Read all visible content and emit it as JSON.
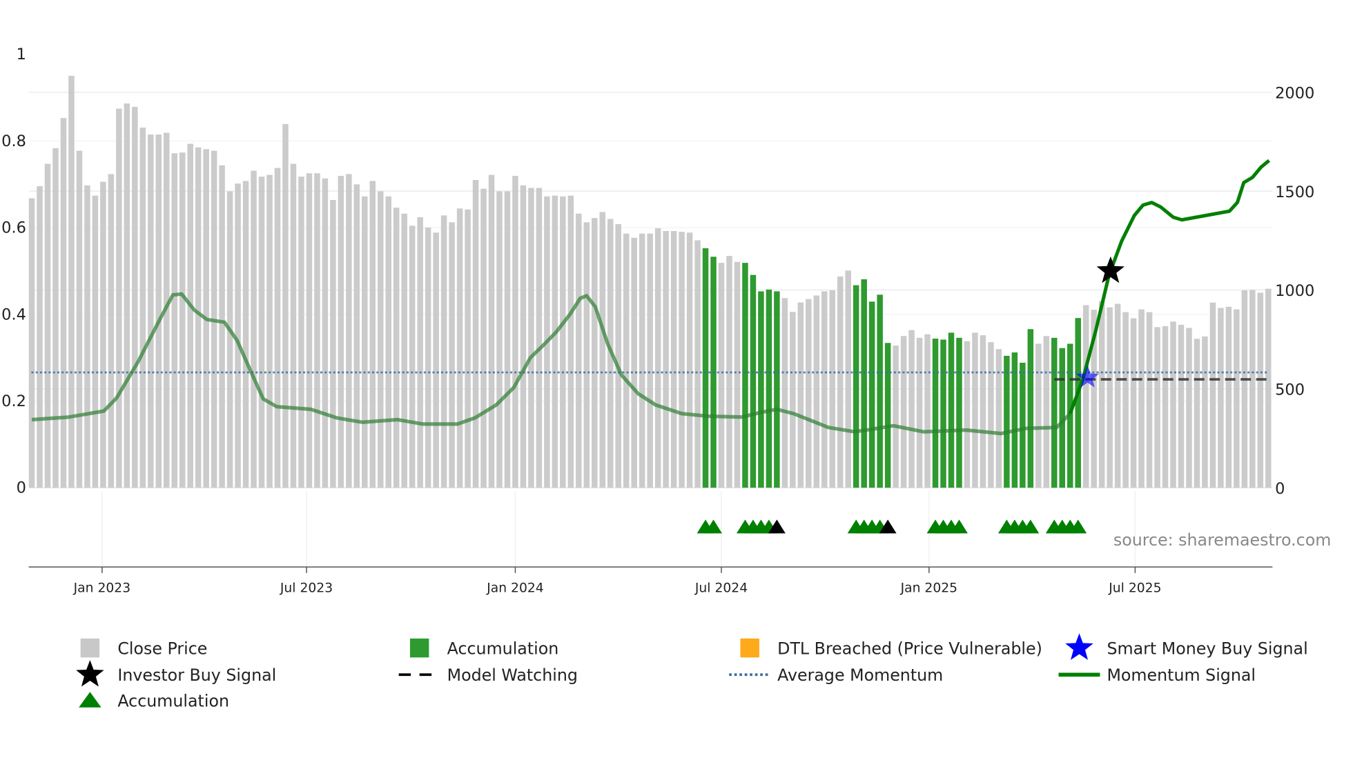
{
  "chart_data": {
    "type": "bar",
    "title": "",
    "source": "source: sharemaestro.com",
    "x_unit": "week index",
    "x_ticks": [
      {
        "label": "Jan 2023",
        "week": 8.87
      },
      {
        "label": "Jul 2023",
        "week": 34.66
      },
      {
        "label": "Jan 2024",
        "week": 61.0
      },
      {
        "label": "Jul 2024",
        "week": 87.0
      },
      {
        "label": "Jan 2025",
        "week": 113.2
      },
      {
        "label": "Jul 2025",
        "week": 139.2
      }
    ],
    "left_axis": {
      "range": [
        0,
        1
      ],
      "ticks": [
        "0",
        "0.2",
        "0.4",
        "0.6",
        "0.8",
        "1"
      ],
      "tick_values": [
        0,
        0.2,
        0.4,
        0.6,
        0.8,
        1
      ]
    },
    "right_axis": {
      "range": [
        0,
        2190
      ],
      "ticks": [
        "0",
        "500",
        "1000",
        "1500",
        "2000"
      ],
      "tick_values": [
        0,
        500,
        1000,
        1500,
        2000
      ]
    },
    "close_price": [
      1464,
      1525,
      1638,
      1717,
      1869,
      2083,
      1704,
      1529,
      1477,
      1547,
      1586,
      1917,
      1943,
      1926,
      1821,
      1786,
      1786,
      1795,
      1691,
      1695,
      1739,
      1721,
      1712,
      1704,
      1630,
      1499,
      1538,
      1551,
      1603,
      1573,
      1582,
      1617,
      1839,
      1638,
      1573,
      1590,
      1590,
      1564,
      1455,
      1577,
      1586,
      1534,
      1473,
      1551,
      1499,
      1473,
      1416,
      1386,
      1325,
      1368,
      1316,
      1290,
      1377,
      1342,
      1412,
      1407,
      1556,
      1512,
      1582,
      1499,
      1499,
      1577,
      1529,
      1516,
      1516,
      1473,
      1477,
      1473,
      1477,
      1386,
      1342,
      1364,
      1394,
      1359,
      1333,
      1285,
      1264,
      1285,
      1285,
      1312,
      1298,
      1298,
      1294,
      1290,
      1251,
      1211,
      1168,
      1137,
      1172,
      1142,
      1137,
      1076,
      993,
      1002,
      993,
      959,
      889,
      937,
      954,
      972,
      993,
      998,
      1068,
      1098,
      1024,
      1054,
      941,
      976,
      732,
      719,
      767,
      797,
      758,
      776,
      754,
      749,
      784,
      758,
      741,
      784,
      771,
      736,
      701,
      667,
      684,
      632,
      802,
      728,
      767,
      758,
      706,
      728,
      858,
      923,
      900,
      944,
      912,
      930,
      888,
      857,
      902,
      888,
      812,
      817,
      840,
      824,
      808,
      753,
      765,
      936,
      909,
      915,
      902,
      998,
      1000,
      986,
      1006
    ],
    "accumulation_weeks": [
      85,
      86,
      90,
      91,
      92,
      93,
      94,
      104,
      105,
      106,
      107,
      108,
      114,
      115,
      116,
      117,
      123,
      124,
      125,
      126,
      129,
      130,
      131,
      132
    ],
    "accumulation_triangles": [
      85,
      86,
      90,
      91,
      92,
      93,
      104,
      105,
      106,
      107,
      114,
      115,
      116,
      117,
      123,
      124,
      125,
      126,
      129,
      130,
      131,
      132
    ],
    "black_triangles": [
      94,
      108
    ],
    "momentum_signal": [
      [
        0,
        0.157
      ],
      [
        4.7,
        0.163
      ],
      [
        9.1,
        0.177
      ],
      [
        10.7,
        0.207
      ],
      [
        13.4,
        0.29
      ],
      [
        16.2,
        0.39
      ],
      [
        17.8,
        0.445
      ],
      [
        18.9,
        0.447
      ],
      [
        20.5,
        0.41
      ],
      [
        22.1,
        0.388
      ],
      [
        24.3,
        0.382
      ],
      [
        25.9,
        0.34
      ],
      [
        27.6,
        0.27
      ],
      [
        29.2,
        0.205
      ],
      [
        30.9,
        0.187
      ],
      [
        35.2,
        0.181
      ],
      [
        38.5,
        0.161
      ],
      [
        41.7,
        0.151
      ],
      [
        46.1,
        0.157
      ],
      [
        49.3,
        0.147
      ],
      [
        53.7,
        0.147
      ],
      [
        55.9,
        0.161
      ],
      [
        58.6,
        0.191
      ],
      [
        60.8,
        0.231
      ],
      [
        62.9,
        0.3
      ],
      [
        64.6,
        0.33
      ],
      [
        66.2,
        0.36
      ],
      [
        67.9,
        0.4
      ],
      [
        69.2,
        0.437
      ],
      [
        70.0,
        0.443
      ],
      [
        71.1,
        0.417
      ],
      [
        72.7,
        0.33
      ],
      [
        74.4,
        0.26
      ],
      [
        76.5,
        0.217
      ],
      [
        78.7,
        0.191
      ],
      [
        82.0,
        0.171
      ],
      [
        85.3,
        0.165
      ],
      [
        89.6,
        0.163
      ],
      [
        91.8,
        0.173
      ],
      [
        94.0,
        0.181
      ],
      [
        96.1,
        0.171
      ],
      [
        100.5,
        0.139
      ],
      [
        103.8,
        0.129
      ],
      [
        106.0,
        0.135
      ],
      [
        108.7,
        0.143
      ],
      [
        112.5,
        0.129
      ],
      [
        117.9,
        0.133
      ],
      [
        122.3,
        0.125
      ],
      [
        125.5,
        0.137
      ],
      [
        129.3,
        0.139
      ],
      [
        131.0,
        0.171
      ],
      [
        132.6,
        0.25
      ],
      [
        134.2,
        0.36
      ],
      [
        135.9,
        0.49
      ],
      [
        137.5,
        0.569
      ],
      [
        139.1,
        0.628
      ],
      [
        140.2,
        0.652
      ],
      [
        141.3,
        0.658
      ],
      [
        142.4,
        0.648
      ],
      [
        144.0,
        0.624
      ],
      [
        145.1,
        0.618
      ],
      [
        151.1,
        0.638
      ],
      [
        152.1,
        0.658
      ],
      [
        152.9,
        0.704
      ],
      [
        154.0,
        0.716
      ],
      [
        155.1,
        0.74
      ],
      [
        156.1,
        0.755
      ]
    ],
    "momentum_bright_from_week": 131,
    "average_momentum": 0.266,
    "model_watching": {
      "from_week": 129,
      "to_week": 156.1,
      "value": 0.25
    },
    "smart_money_buy_signal": {
      "week": 133.2,
      "value": 0.254
    },
    "investor_buy_signal": {
      "week": 136.1,
      "value": 0.5
    },
    "colors": {
      "close_price": "#c8c8c8",
      "accumulation": "#2f9a2f",
      "triangle": "#008000",
      "dtl": "#ffa91c",
      "smart_money": "#0000ff",
      "investor": "#000000",
      "avg_momentum": "#3a6fa0",
      "momentum": "#008000"
    },
    "legend": [
      {
        "label": "Close Price",
        "icon": "gray-square-icon"
      },
      {
        "label": "Accumulation",
        "icon": "green-square-icon"
      },
      {
        "label": "DTL Breached (Price Vulnerable)",
        "icon": "orange-square-icon"
      },
      {
        "label": "Smart Money Buy Signal",
        "icon": "blue-star-icon"
      },
      {
        "label": "Investor Buy Signal",
        "icon": "black-star-icon"
      },
      {
        "label": "Model Watching",
        "icon": "dashed-line-icon"
      },
      {
        "label": "Average Momentum",
        "icon": "dotted-line-icon"
      },
      {
        "label": "Momentum Signal",
        "icon": "solid-line-icon"
      },
      {
        "label": "Accumulation",
        "icon": "green-triangle-icon"
      }
    ],
    "legend_placement": "bottom"
  }
}
